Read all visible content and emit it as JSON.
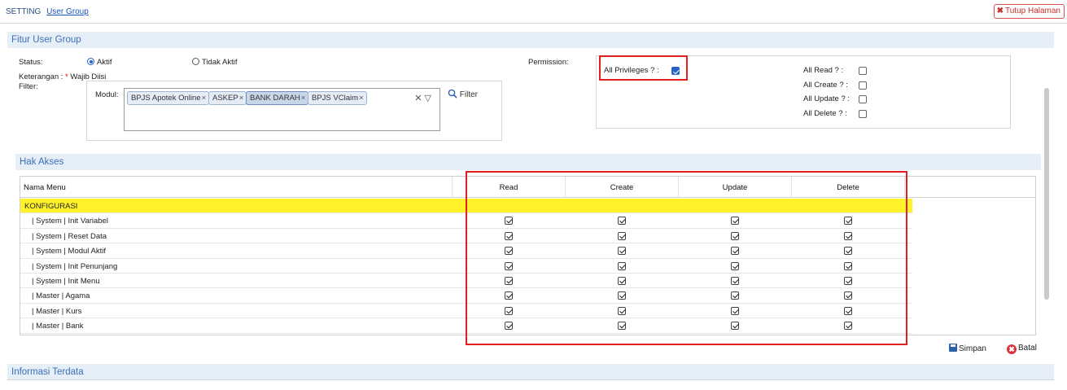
{
  "breadcrumb": {
    "root": "SETTING",
    "current": "User Group"
  },
  "header": {
    "close_icon": "✖",
    "close_label": "Tutup Halaman"
  },
  "sections": {
    "fitur": "Fitur User Group",
    "hak_akses": "Hak Akses",
    "informasi": "Informasi Terdata"
  },
  "form": {
    "status_label": "Status:",
    "status_options": [
      "Aktif",
      "Tidak Aktif"
    ],
    "status_selected": "Aktif",
    "keterangan_label": "Keterangan :",
    "keterangan_req": "*",
    "keterangan_value": "Wajib Diisi",
    "filter_label": "Filter:",
    "modul_label": "Modul:",
    "modul_chips": [
      "BPJS Apotek Online",
      "ASKEP",
      "BANK DARAH",
      "BPJS VClaim"
    ],
    "modul_highlighted": "BANK DARAH",
    "chip_remove_icon": "×",
    "clear_icon": "✕",
    "dropdown_icon": "▽",
    "filter_icon": "search-icon",
    "filter_button": "Filter"
  },
  "permission": {
    "label": "Permission:",
    "all_privileges": {
      "label": "All Privileges ? :",
      "checked": true
    },
    "all_read": {
      "label": "All Read ? :",
      "checked": false
    },
    "all_create": {
      "label": "All Create ? :",
      "checked": false
    },
    "all_update": {
      "label": "All Update ? :",
      "checked": false
    },
    "all_delete": {
      "label": "All Delete ? :",
      "checked": false
    }
  },
  "table": {
    "columns": [
      "Nama Menu",
      "Read",
      "Create",
      "Update",
      "Delete"
    ],
    "group": "KONFIGURASI",
    "rows": [
      {
        "name": "| System | Init Variabel",
        "read": true,
        "create": true,
        "update": true,
        "delete": true
      },
      {
        "name": "| System | Reset Data",
        "read": true,
        "create": true,
        "update": true,
        "delete": true
      },
      {
        "name": "| System | Modul Aktif",
        "read": true,
        "create": true,
        "update": true,
        "delete": true
      },
      {
        "name": "| System | Init Penunjang",
        "read": true,
        "create": true,
        "update": true,
        "delete": true
      },
      {
        "name": "| System | Init Menu",
        "read": true,
        "create": true,
        "update": true,
        "delete": true
      },
      {
        "name": "| Master | Agama",
        "read": true,
        "create": true,
        "update": true,
        "delete": true
      },
      {
        "name": "| Master | Kurs",
        "read": true,
        "create": true,
        "update": true,
        "delete": true
      },
      {
        "name": "| Master | Bank",
        "read": true,
        "create": true,
        "update": true,
        "delete": true
      }
    ]
  },
  "actions": {
    "save": "Simpan",
    "cancel": "Batal",
    "cancel_icon": "✖"
  },
  "colors": {
    "accent": "#3b6fb6",
    "group_row": "#fff22a",
    "highlight_border": "#e02020"
  }
}
